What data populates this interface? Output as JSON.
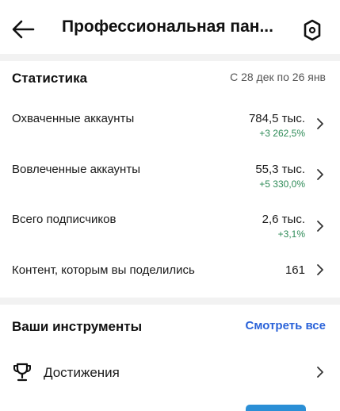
{
  "header": {
    "title": "Профессиональная пан..."
  },
  "stats": {
    "title": "Статистика",
    "date_range": "С 28 дек по 26 янв",
    "rows": [
      {
        "label": "Охваченные аккаунты",
        "value": "784,5 тыс.",
        "change": "+3 262,5%"
      },
      {
        "label": "Вовлеченные аккаунты",
        "value": "55,3 тыс.",
        "change": "+5 330,0%"
      },
      {
        "label": "Всего подписчиков",
        "value": "2,6 тыс.",
        "change": "+3,1%"
      },
      {
        "label": "Контент, которым вы поделились",
        "value": "161",
        "change": ""
      }
    ]
  },
  "tools": {
    "title": "Ваши инструменты",
    "see_all": "Смотреть все",
    "items": [
      {
        "label": "Достижения",
        "icon": "trophy-icon"
      }
    ]
  },
  "colors": {
    "accent": "#2b63d9",
    "positive": "#2e8b57"
  }
}
